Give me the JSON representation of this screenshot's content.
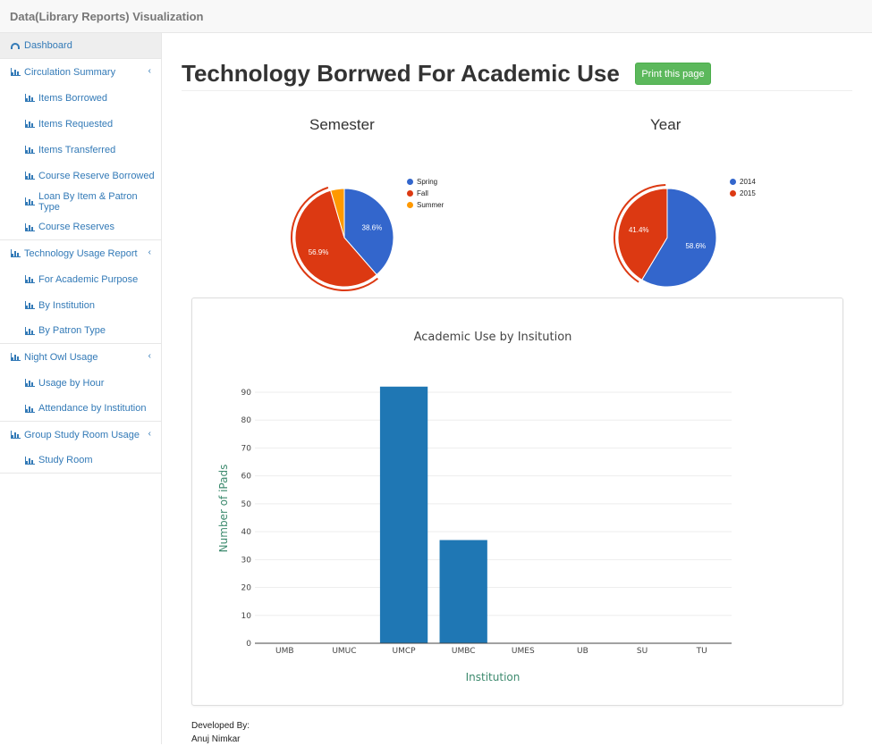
{
  "app": {
    "brand": "Data(Library Reports) Visualization"
  },
  "sidebar": {
    "items": [
      {
        "label": "Dashboard",
        "level": 1,
        "icon": "dashboard-icon",
        "active": true
      },
      {
        "label": "Circulation Summary",
        "level": 1,
        "icon": "bar-chart-icon",
        "expandable": true
      },
      {
        "label": "Items Borrowed",
        "level": 2,
        "icon": "bar-chart-icon"
      },
      {
        "label": "Items Requested",
        "level": 2,
        "icon": "bar-chart-icon"
      },
      {
        "label": "Items Transferred",
        "level": 2,
        "icon": "bar-chart-icon"
      },
      {
        "label": "Course Reserve Borrowed",
        "level": 2,
        "icon": "bar-chart-icon"
      },
      {
        "label": "Loan By Item & Patron Type",
        "level": 2,
        "icon": "bar-chart-icon"
      },
      {
        "label": "Course Reserves",
        "level": 2,
        "icon": "bar-chart-icon"
      },
      {
        "label": "Technology Usage Report",
        "level": 1,
        "icon": "bar-chart-icon",
        "expandable": true
      },
      {
        "label": "For Academic Purpose",
        "level": 2,
        "icon": "bar-chart-icon"
      },
      {
        "label": "By Institution",
        "level": 2,
        "icon": "bar-chart-icon"
      },
      {
        "label": "By Patron Type",
        "level": 2,
        "icon": "bar-chart-icon"
      },
      {
        "label": "Night Owl Usage",
        "level": 1,
        "icon": "bar-chart-icon",
        "expandable": true
      },
      {
        "label": "Usage by Hour",
        "level": 2,
        "icon": "bar-chart-icon"
      },
      {
        "label": "Attendance by Institution",
        "level": 2,
        "icon": "bar-chart-icon"
      },
      {
        "label": "Group Study Room Usage",
        "level": 1,
        "icon": "bar-chart-icon",
        "expandable": true
      },
      {
        "label": "Study Room",
        "level": 2,
        "icon": "bar-chart-icon"
      }
    ],
    "chevron": "‹"
  },
  "main": {
    "title": "Technology Borrwed For Academic Use",
    "print_button": "Print this page"
  },
  "chart_data": [
    {
      "type": "pie",
      "title": "Semester",
      "slices": [
        {
          "label": "Spring",
          "value": 38.6,
          "display": "38.6%",
          "color": "#3366cc"
        },
        {
          "label": "Fall",
          "value": 56.9,
          "display": "56.9%",
          "color": "#dc3912"
        },
        {
          "label": "Summer",
          "value": 4.5,
          "display": "",
          "color": "#ff9900"
        }
      ],
      "legend": "right"
    },
    {
      "type": "pie",
      "title": "Year",
      "slices": [
        {
          "label": "2014",
          "value": 58.6,
          "display": "58.6%",
          "color": "#3366cc"
        },
        {
          "label": "2015",
          "value": 41.4,
          "display": "41.4%",
          "color": "#dc3912"
        }
      ],
      "legend": "right"
    },
    {
      "type": "bar",
      "title": "Academic Use by Insitution",
      "xlabel": "Institution",
      "ylabel": "Number of iPads",
      "categories": [
        "UMB",
        "UMUC",
        "UMCP",
        "UMBC",
        "UMES",
        "UB",
        "SU",
        "TU"
      ],
      "values": [
        0,
        0,
        92,
        37,
        0,
        0,
        0,
        0
      ],
      "ylim": [
        0,
        90
      ],
      "yticks": [
        0,
        10,
        20,
        30,
        40,
        50,
        60,
        70,
        80,
        90
      ],
      "grid": true,
      "bar_color": "#1f77b4",
      "label_color": "#3d8a6e"
    }
  ],
  "footer": {
    "line1": "Developed By:",
    "line2": "Anuj Nimkar"
  }
}
